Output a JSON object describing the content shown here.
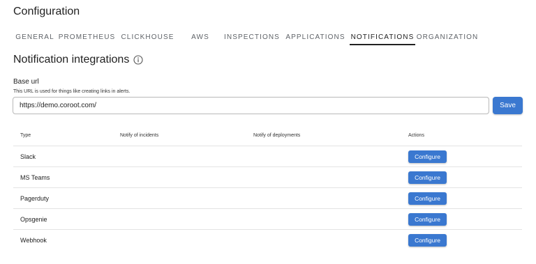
{
  "header": {
    "title": "Configuration"
  },
  "tabs": [
    {
      "id": "general",
      "label": "GENERAL"
    },
    {
      "id": "prometheus",
      "label": "PROMETHEUS"
    },
    {
      "id": "clickhouse",
      "label": "CLICKHOUSE"
    },
    {
      "id": "aws",
      "label": "AWS"
    },
    {
      "id": "inspections",
      "label": "INSPECTIONS"
    },
    {
      "id": "applications",
      "label": "APPLICATIONS"
    },
    {
      "id": "notifications",
      "label": "NOTIFICATIONS",
      "active": true
    },
    {
      "id": "organization",
      "label": "ORGANIZATION"
    }
  ],
  "section": {
    "title": "Notification integrations",
    "info_icon": "info-icon"
  },
  "base_url": {
    "label": "Base url",
    "hint": "This URL is used for things like creating links in alerts.",
    "value": "https://demo.coroot.com/",
    "save_label": "Save"
  },
  "table": {
    "columns": [
      "Type",
      "Notify of incidents",
      "Notify of deployments",
      "Actions"
    ],
    "rows": [
      {
        "type": "Slack",
        "action": "Configure"
      },
      {
        "type": "MS Teams",
        "action": "Configure"
      },
      {
        "type": "Pagerduty",
        "action": "Configure"
      },
      {
        "type": "Opsgenie",
        "action": "Configure"
      },
      {
        "type": "Webhook",
        "action": "Configure"
      }
    ]
  },
  "colors": {
    "primary": "#3a78d0",
    "text": "#212121",
    "tab_inactive": "#5f6368",
    "divider": "#e3e3e3"
  }
}
